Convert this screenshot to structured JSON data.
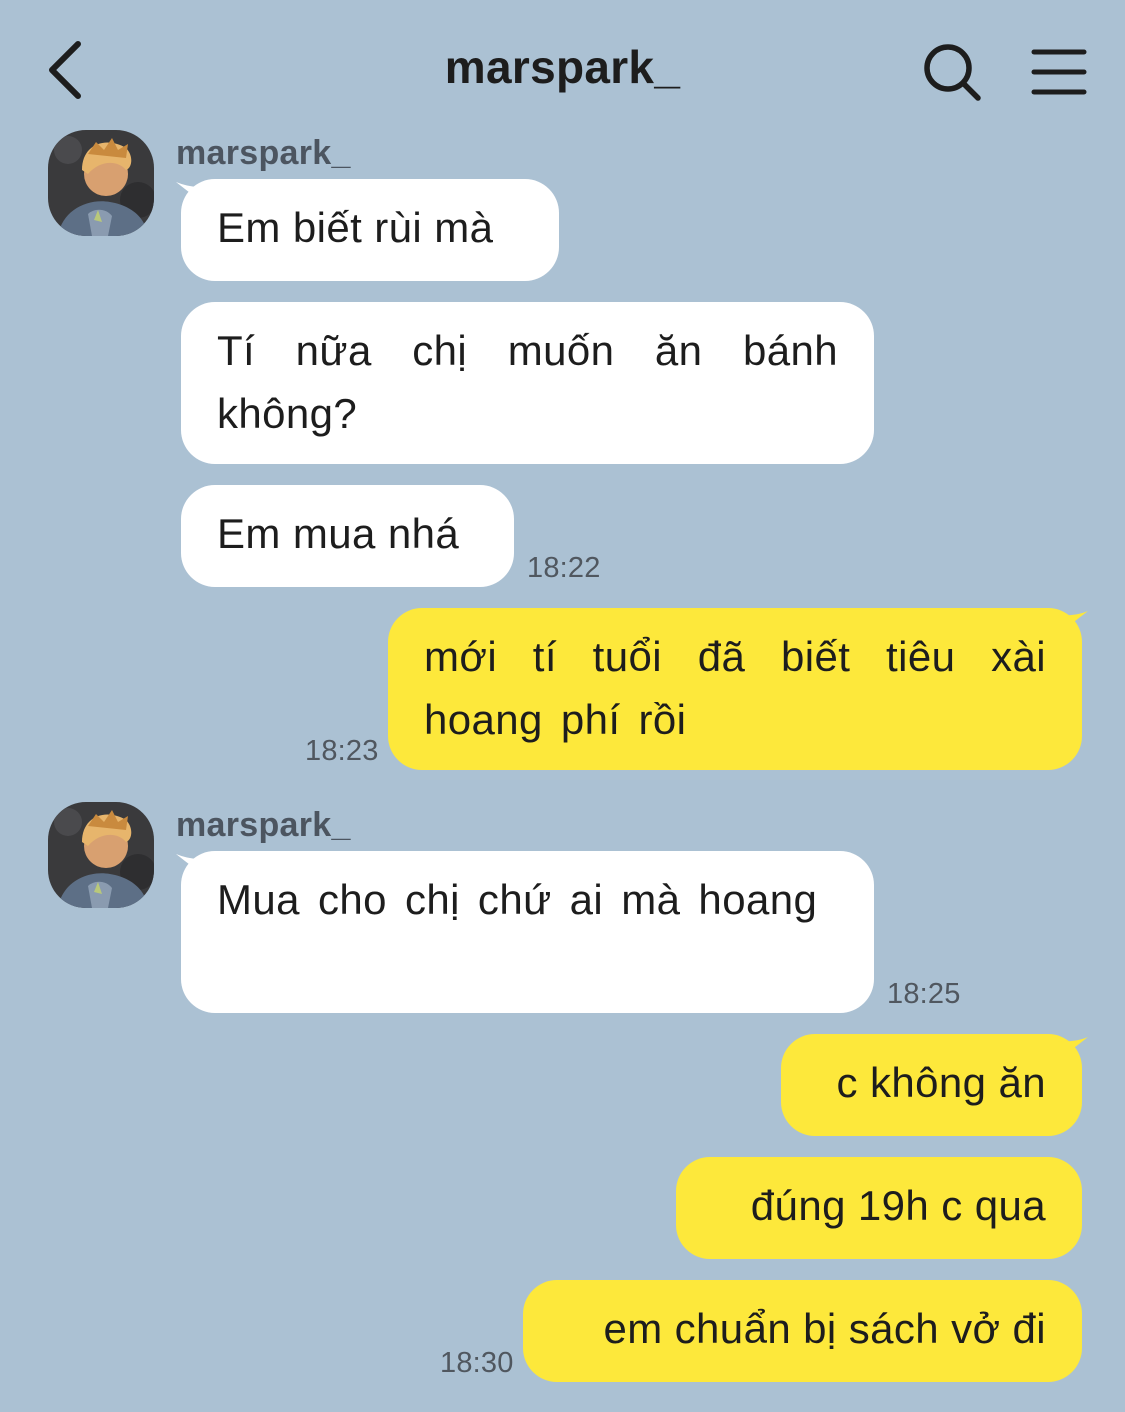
{
  "header": {
    "title": "marspark_",
    "back_icon": "chevron-left-icon",
    "search_icon": "search-icon",
    "menu_icon": "hamburger-menu-icon"
  },
  "colors": {
    "background": "#abc1d3",
    "incoming_bubble": "#ffffff",
    "outgoing_bubble": "#fde83b",
    "text": "#1d1d1d"
  },
  "messages": {
    "group1": {
      "sender": "marspark_",
      "m1": "Em biết rùi mà",
      "m2": "Tí nữa chị muốn ăn bánh không?",
      "m3": "Em mua nhá",
      "time": "18:22"
    },
    "out1": {
      "m1": "mới tí tuổi đã biết tiêu xài hoang phí rồi",
      "time": "18:23"
    },
    "group2": {
      "sender": "marspark_",
      "m1": "Mua cho chị chứ ai mà hoang",
      "time": "18:25"
    },
    "out2": {
      "m1": "c không ăn",
      "m2": "đúng 19h c qua",
      "m3": "em chuẩn bị sách vở đi",
      "time": "18:30"
    }
  }
}
